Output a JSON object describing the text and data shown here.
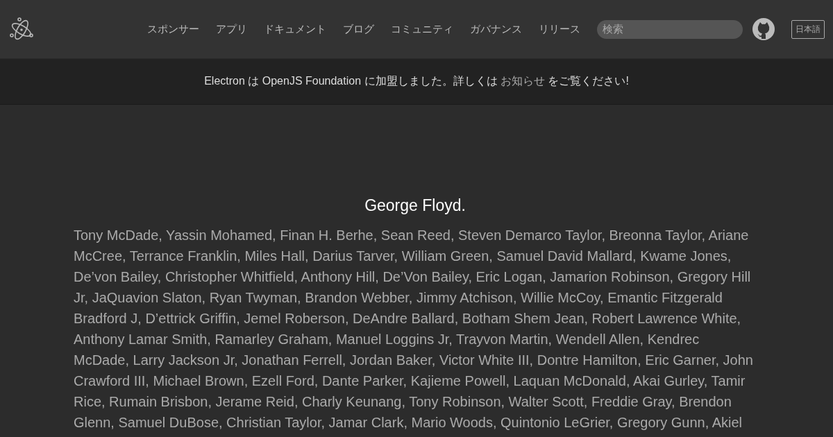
{
  "nav": {
    "items": [
      "スポンサー",
      "アプリ",
      "ドキュメント",
      "ブログ",
      "コミュニティ",
      "ガバナンス",
      "リリース"
    ],
    "search": {
      "placeholder": "検索"
    },
    "language": "日本語"
  },
  "banner": {
    "text_before": "Electron は OpenJS Foundation に加盟しました。詳しくは ",
    "link": "お知らせ",
    "text_after": " をご覧ください!"
  },
  "tribute": {
    "heading": "George Floyd.",
    "names": "Tony McDade, Yassin Mohamed, Finan H. Berhe, Sean Reed, Steven Demarco Taylor, Breonna Taylor, Ariane McCree, Terrance Franklin, Miles Hall, Darius Tarver, William Green, Samuel David Mallard, Kwame Jones, De’von Bailey, Christopher Whitfield, Anthony Hill, De’Von Bailey, Eric Logan, Jamarion Robinson, Gregory Hill Jr, JaQuavion Slaton, Ryan Twyman, Brandon Webber, Jimmy Atchison, Willie McCoy, Emantic Fitzgerald Bradford J, D’ettrick Griffin, Jemel Roberson, DeAndre Ballard, Botham Shem Jean, Robert Lawrence White, Anthony Lamar Smith, Ramarley Graham, Manuel Loggins Jr, Trayvon Martin, Wendell Allen, Kendrec McDade, Larry Jackson Jr, Jonathan Ferrell, Jordan Baker, Victor White III, Dontre Hamilton, Eric Garner, John Crawford III, Michael Brown, Ezell Ford, Dante Parker, Kajieme Powell, Laquan McDonald, Akai Gurley, Tamir Rice, Rumain Brisbon, Jerame Reid, Charly Keunang, Tony Robinson, Walter Scott, Freddie Gray, Brendon Glenn, Samuel DuBose, Christian Taylor, Jamar Clark, Mario Woods, Quintonio LeGrier, Gregory Gunn, Akiel"
  }
}
